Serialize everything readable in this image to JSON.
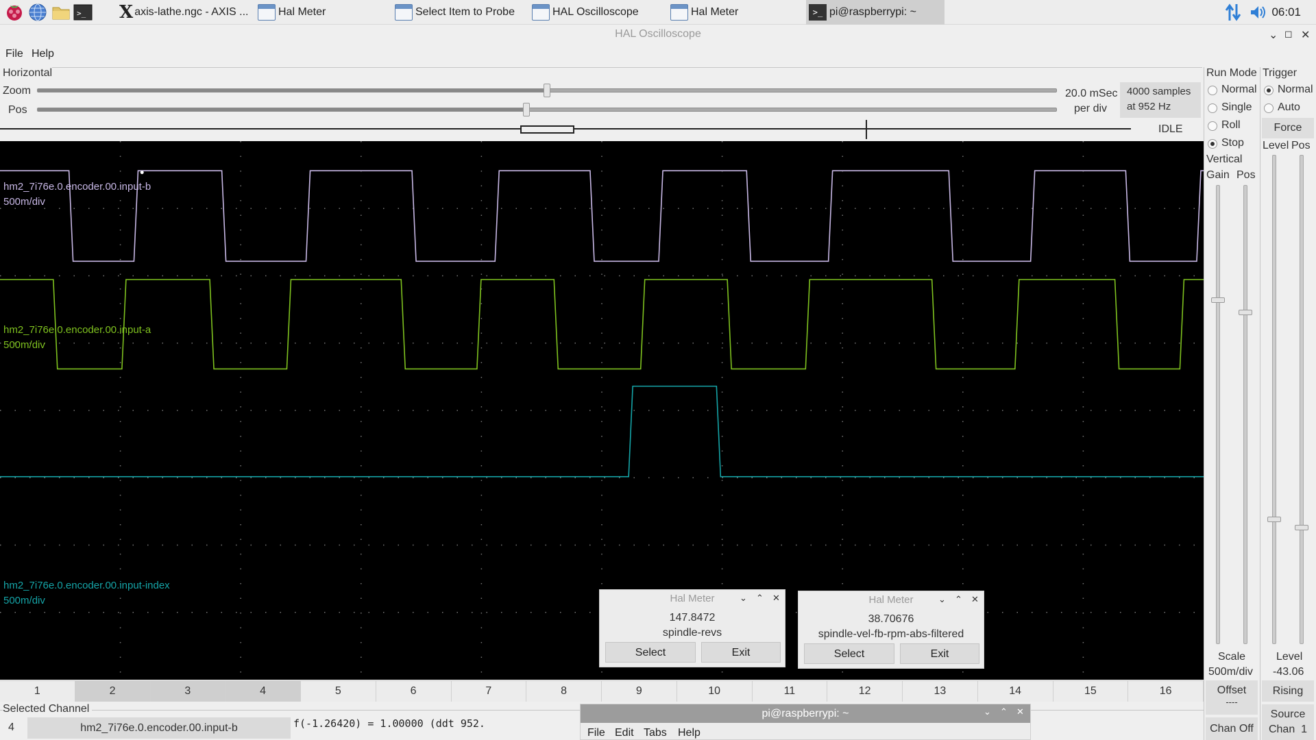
{
  "taskbar": {
    "tasks": [
      {
        "label": "axis-lathe.ngc - AXIS ..."
      },
      {
        "label": "Hal Meter"
      },
      {
        "label": "Select Item to Probe"
      },
      {
        "label": "HAL Oscilloscope"
      },
      {
        "label": "Hal Meter"
      },
      {
        "label": "pi@raspberrypi: ~"
      }
    ],
    "clock": "06:01"
  },
  "window": {
    "title": "HAL Oscilloscope",
    "controls": {
      "minimize": "⌄",
      "maximize": "◻",
      "close": "✕"
    }
  },
  "menu": [
    "File",
    "Help"
  ],
  "horizontal": {
    "title": "Horizontal",
    "zoom_label": "Zoom",
    "pos_label": "Pos",
    "zoom_value": 0.5,
    "pos_value": 0.48,
    "rate_line1": "20.0 mSec",
    "rate_line2": "per div",
    "samples_line1": "4000 samples",
    "samples_line2": "at 952 Hz",
    "status": "IDLE"
  },
  "traces": [
    {
      "name": "hm2_7i76e.0.encoder.00.input-b",
      "scale": "500m/div",
      "color": "#c8b8e6"
    },
    {
      "name": "hm2_7i76e.0.encoder.00.input-a",
      "scale": "500m/div",
      "color": "#7fc21f"
    },
    {
      "name": "hm2_7i76e.0.encoder.00.input-index",
      "scale": "500m/div",
      "color": "#15a5a8"
    }
  ],
  "channels": {
    "buttons": [
      "1",
      "2",
      "3",
      "4",
      "5",
      "6",
      "7",
      "8",
      "9",
      "10",
      "11",
      "12",
      "13",
      "14",
      "15",
      "16"
    ],
    "active": [
      2,
      3,
      4
    ]
  },
  "run_mode": {
    "title": "Run Mode",
    "options": [
      "Normal",
      "Single",
      "Roll",
      "Stop"
    ],
    "selected": "Stop"
  },
  "trigger": {
    "title": "Trigger",
    "options": [
      "Normal",
      "Auto"
    ],
    "selected": "Normal",
    "force": "Force",
    "level_label": "Level",
    "pos_label": "Pos",
    "level_footer": "Level",
    "level_value": "-43.06",
    "edge": "Rising",
    "source_line1": "Source",
    "source_line2": "Chan  1"
  },
  "vertical": {
    "title": "Vertical",
    "gain_label": "Gain",
    "pos_label": "Pos",
    "scale_label": "Scale",
    "scale_value": "500m/div",
    "offset_label": "Offset",
    "offset_value": "----",
    "chan_off": "Chan Off"
  },
  "selected_channel": {
    "label": "Selected Channel",
    "number": "4",
    "name": "hm2_7i76e.0.encoder.00.input-b",
    "formula": "f(-1.26420) =  1.00000 (ddt  952."
  },
  "meters": [
    {
      "title": "Hal Meter",
      "value": "147.8472",
      "signal": "spindle-revs",
      "select": "Select",
      "exit": "Exit"
    },
    {
      "title": "Hal Meter",
      "value": "38.70676",
      "signal": "spindle-vel-fb-rpm-abs-filtered",
      "select": "Select",
      "exit": "Exit"
    }
  ],
  "terminal": {
    "title": "pi@raspberrypi: ~",
    "menu": [
      "File",
      "Edit",
      "Tabs",
      "Help"
    ]
  }
}
